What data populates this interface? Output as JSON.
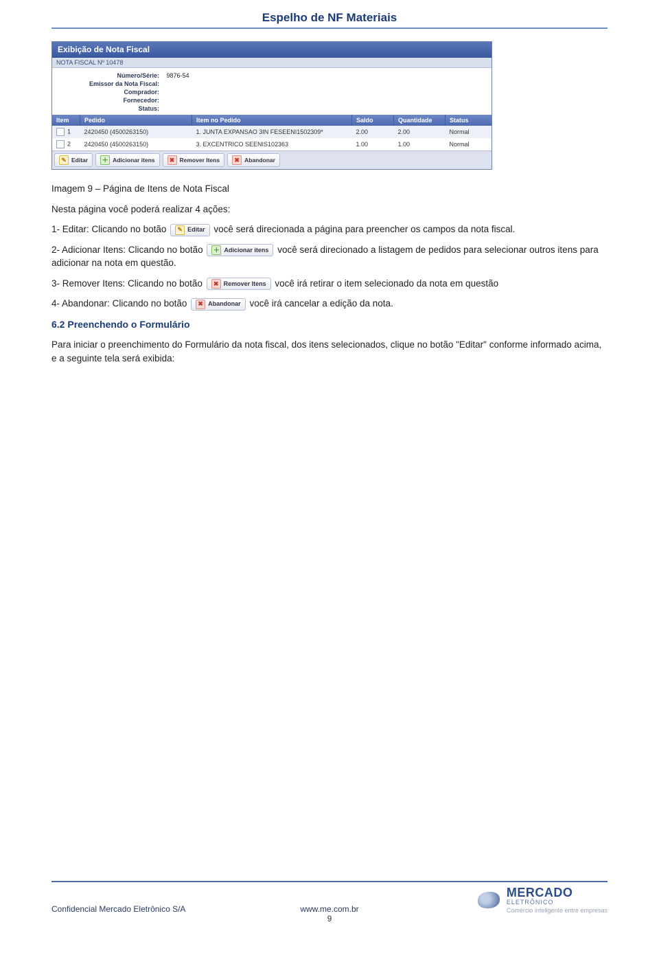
{
  "header": {
    "title": "Espelho de NF Materiais"
  },
  "panel": {
    "title": "Exibição de Nota Fiscal",
    "subband": "NOTA FISCAL Nº 10478",
    "fields": {
      "numero_serie_label": "Número/Série:",
      "numero_serie_value": "9876-54",
      "emissor_label": "Emissor da Nota Fiscal:",
      "emissor_value": "",
      "comprador_label": "Comprador:",
      "comprador_value": "",
      "fornecedor_label": "Fornecedor:",
      "fornecedor_value": "",
      "status_label": "Status:",
      "status_value": ""
    },
    "table": {
      "headers": [
        "Item",
        "Pedido",
        "Item no Pedido",
        "Saldo",
        "Quantidade",
        "Status"
      ],
      "rows": [
        {
          "item": "1",
          "pedido": "2420450 (4500263150)",
          "descricao": "1. JUNTA EXPANSAO 3IN FESEENI1502309*",
          "saldo": "2.00",
          "quantidade": "2.00",
          "status": "Normal"
        },
        {
          "item": "2",
          "pedido": "2420450 (4500263150)",
          "descricao": "3. EXCENTRICO SEENIS102363",
          "saldo": "1.00",
          "quantidade": "1.00",
          "status": "Normal"
        }
      ]
    },
    "toolbar": {
      "editar": "Editar",
      "adicionar": "Adicionar itens",
      "remover": "Remover Itens",
      "abandonar": "Abandonar"
    }
  },
  "body": {
    "caption": "Imagem 9 – Página de Itens de Nota Fiscal",
    "intro": "Nesta página você poderá realizar 4 ações:",
    "item1_a": "1- Editar: Clicando no botão ",
    "item1_btn": "Editar",
    "item1_b": " você será direcionada a página para preencher os campos da nota fiscal.",
    "item2_a": "2- Adicionar Itens: Clicando no botão ",
    "item2_btn": "Adicionar itens",
    "item2_b": " você será direcionado a listagem de pedidos para selecionar outros itens para adicionar na nota em questão.",
    "item3_a": "3- Remover Itens: Clicando no botão ",
    "item3_btn": "Remover Itens",
    "item3_b": " você irá retirar o item selecionado da nota em questão",
    "item4_a": "4- Abandonar: Clicando no botão ",
    "item4_btn": "Abandonar",
    "item4_b": " você irá cancelar a edição da nota.",
    "section_head": "6.2 Preenchendo o Formulário",
    "section_body": "Para iniciar o preenchimento do Formulário da nota fiscal, dos itens selecionados, clique no botão \"Editar\" conforme informado acima, e a seguinte tela será exibida:"
  },
  "footer": {
    "confidential": "Confidencial Mercado Eletrônico S/A",
    "url": "www.me.com.br",
    "brand_name": "MERCADO",
    "brand_sub": "ELETRÔNICO",
    "brand_tag": "Comércio inteligente entre empresas",
    "page_number": "9"
  }
}
